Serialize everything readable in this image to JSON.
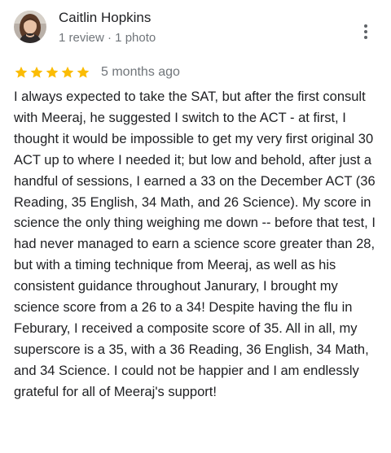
{
  "reviewer": {
    "name": "Caitlin Hopkins",
    "meta": "1 review · 1 photo"
  },
  "rating": {
    "stars": 5,
    "max": 5,
    "star_color": "#fbbc04",
    "date": "5 months ago"
  },
  "more_icon": "more-vert-icon",
  "review": {
    "text": "I always expected to take the SAT, but after the first consult with Meeraj, he suggested I switch to the ACT - at first, I thought it would be impossible to get my very first original 30 ACT up to where I needed it; but low and behold, after just a handful of sessions, I earned a 33 on the December ACT (36 Reading, 35 English, 34 Math, and 26 Science). My score in science the only thing weighing me down -- before that test, I had never managed to earn a science score greater than 28, but with a timing technique from Meeraj, as well as his consistent guidance throughout Janurary, I brought my science score from a 26 to a 34! Despite having the flu in Feburary, I received a composite score of 35. All in all, my superscore is a 35, with a 36 Reading, 36 English, 34 Math, and 34 Science. I could not be happier and I am endlessly grateful for all of Meeraj's support!"
  }
}
